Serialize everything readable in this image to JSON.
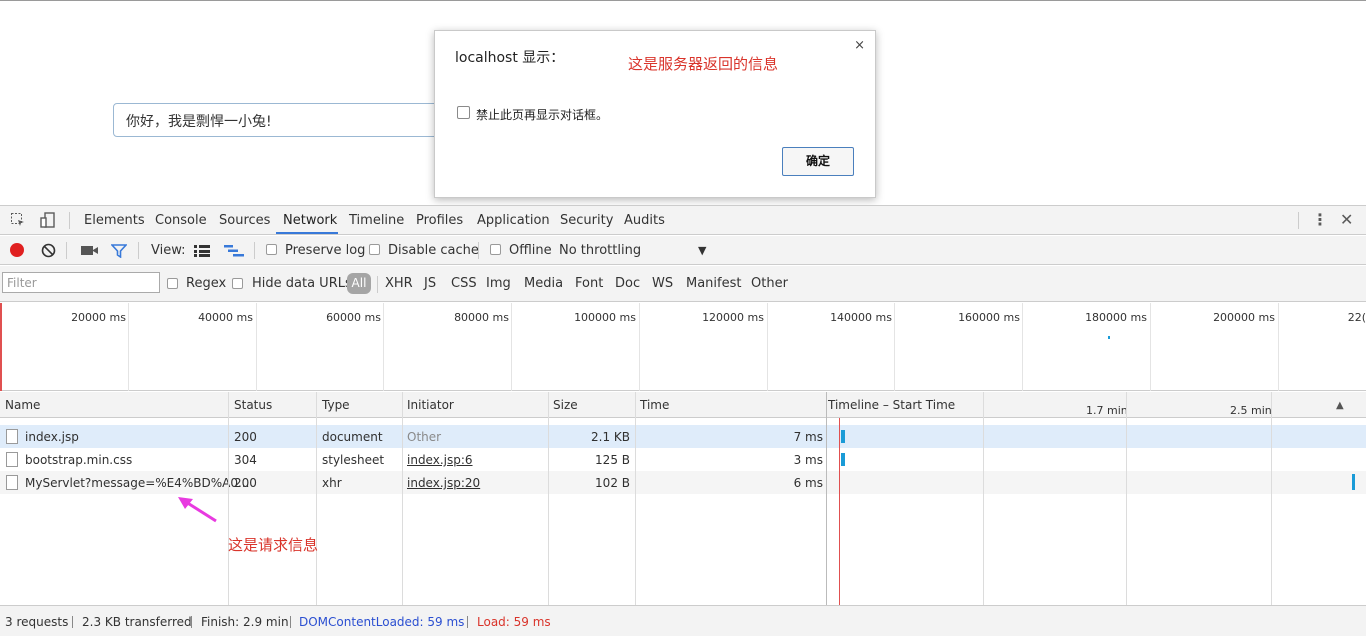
{
  "page": {
    "input_value": "你好，我是剽悍一小兔!"
  },
  "dialog": {
    "title": "localhost 显示：",
    "checkbox_label": "禁止此页再显示对话框。",
    "ok_label": "确定",
    "close_symbol": "×"
  },
  "annotations": {
    "server_response": "这是服务器返回的信息",
    "request_info": "这是请求信息"
  },
  "devtools": {
    "tabs": [
      "Elements",
      "Console",
      "Sources",
      "Network",
      "Timeline",
      "Profiles",
      "Application",
      "Security",
      "Audits"
    ],
    "active_tab": "Network",
    "toolbar": {
      "view_label": "View:",
      "preserve_log": "Preserve log",
      "disable_cache": "Disable cache",
      "offline": "Offline",
      "throttling": "No throttling"
    },
    "filter": {
      "placeholder": "Filter",
      "regex": "Regex",
      "hide_data_urls": "Hide data URLs",
      "types": [
        "All",
        "XHR",
        "JS",
        "CSS",
        "Img",
        "Media",
        "Font",
        "Doc",
        "WS",
        "Manifest",
        "Other"
      ]
    },
    "overview_ticks": [
      "20000 ms",
      "40000 ms",
      "60000 ms",
      "80000 ms",
      "100000 ms",
      "120000 ms",
      "140000 ms",
      "160000 ms",
      "180000 ms",
      "200000 ms",
      "22("
    ],
    "columns": [
      "Name",
      "Status",
      "Type",
      "Initiator",
      "Size",
      "Time",
      "Timeline – Start Time"
    ],
    "timeline_ticks": [
      "1.7 min",
      "2.5 min"
    ],
    "rows": [
      {
        "name": "index.jsp",
        "status": "200",
        "type": "document",
        "initiator": "Other",
        "size": "2.1 KB",
        "time": "7 ms"
      },
      {
        "name": "bootstrap.min.css",
        "status": "304",
        "type": "stylesheet",
        "initiator": "index.jsp:6",
        "size": "125 B",
        "time": "3 ms"
      },
      {
        "name": "MyServlet?message=%E4%BD%A0...",
        "status": "200",
        "type": "xhr",
        "initiator": "index.jsp:20",
        "size": "102 B",
        "time": "6 ms"
      }
    ],
    "status_bar": {
      "requests": "3 requests",
      "transferred": "2.3 KB transferred",
      "finish": "Finish: 2.9 min",
      "dom_content_loaded": "DOMContentLoaded: 59 ms",
      "load": "Load: 59 ms"
    },
    "colors": {
      "accent": "#3879d9",
      "record": "#e02020",
      "dcl": "#2b4fd1",
      "load": "#d9342b",
      "waterfall": "#1a9bd7"
    }
  }
}
